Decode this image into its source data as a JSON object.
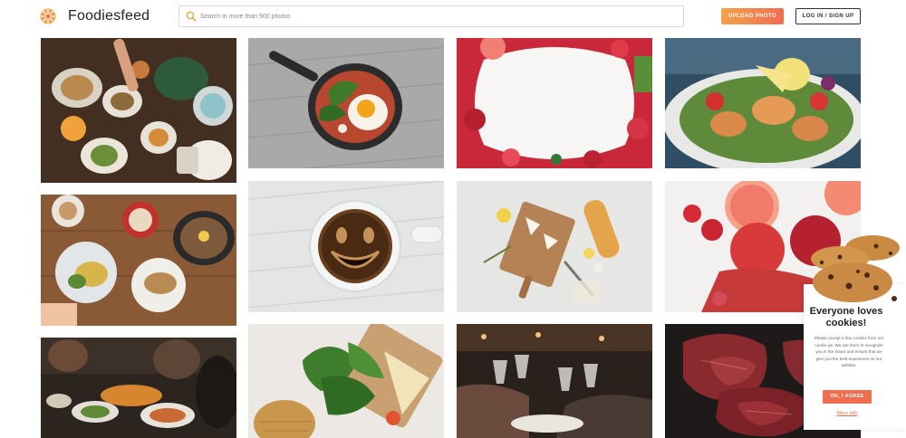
{
  "header": {
    "brand": "Foodiesfeed",
    "search_placeholder": "Search in more than 900 photos",
    "upload_label": "UPLOAD PHOTO",
    "login_label": "LOG IN / SIGN UP"
  },
  "photos": [
    {
      "subject": "table-spread-drinks"
    },
    {
      "subject": "skillet-egg-spinach"
    },
    {
      "subject": "fruit-frame-on-white"
    },
    {
      "subject": "salmon-salad-lemon"
    },
    {
      "subject": "brunch-table-coffee"
    },
    {
      "subject": "smiley-coffee-cup"
    },
    {
      "subject": "cheese-board-baguette"
    },
    {
      "subject": "grapefruit-apples-goji"
    },
    {
      "subject": "friends-dinner-table"
    },
    {
      "subject": "greens-cheese-board"
    },
    {
      "subject": "wine-toast"
    },
    {
      "subject": "raw-beef-steaks"
    }
  ],
  "cookie": {
    "title": "Everyone loves cookies!",
    "body": "Please accept a few cookies from our cookie jar. We use them to recognize you in the future and ensure that we give you the best experience on our website.",
    "ok_label": "OK, I AGREE",
    "more_label": "More info"
  },
  "colors": {
    "accent": "#f16d4f",
    "accent_light": "#f4a24c"
  }
}
